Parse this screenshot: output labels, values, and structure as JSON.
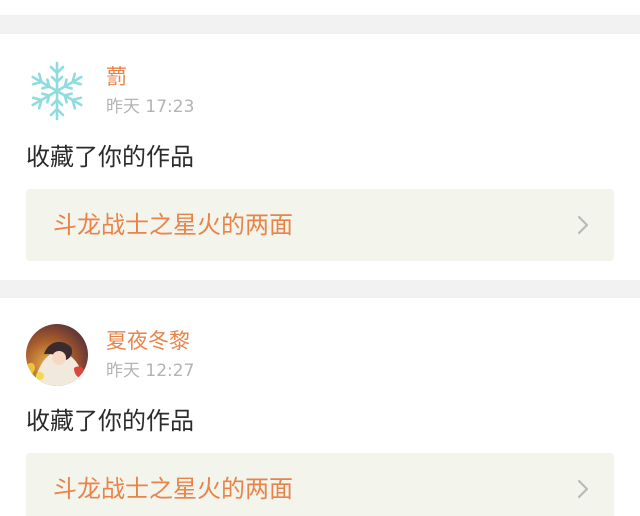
{
  "notifications": [
    {
      "username": "藅",
      "timestamp": "昨天 17:23",
      "action": "收藏了你的作品",
      "work_title": "斗龙战士之星火的两面",
      "avatar_icon": "snowflake-icon",
      "avatar_color": "#8fdbe0"
    },
    {
      "username": "夏夜冬黎",
      "timestamp": "昨天 12:27",
      "action": "收藏了你的作品",
      "work_title": "斗龙战士之星火的两面",
      "avatar_icon": "anime-character-avatar",
      "avatar_color": "#c98a3a"
    }
  ],
  "colors": {
    "accent": "#e8844a",
    "muted": "#b3b3b3",
    "text": "#2b2b2b",
    "work_box_bg": "#f3f5ec",
    "page_bg": "#f2f2f2"
  }
}
